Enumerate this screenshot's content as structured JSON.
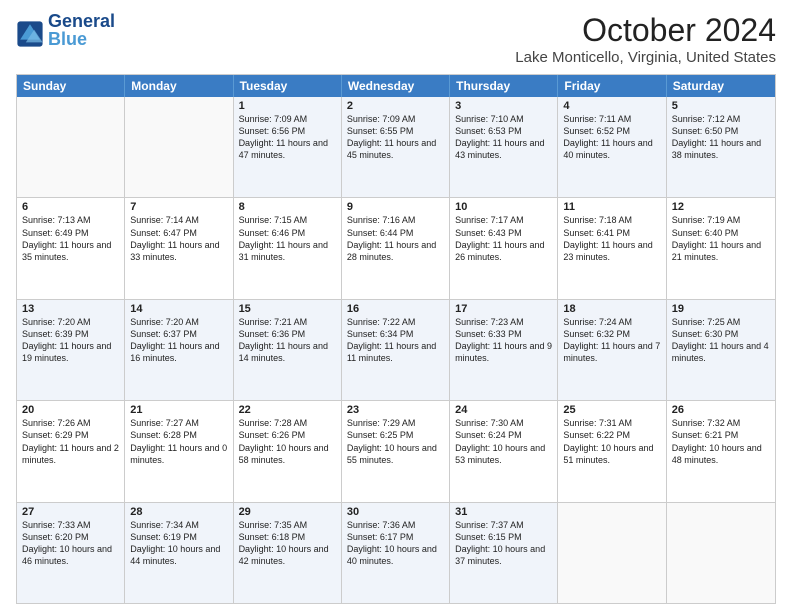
{
  "header": {
    "logo_text_general": "General",
    "logo_text_blue": "Blue",
    "main_title": "October 2024",
    "subtitle": "Lake Monticello, Virginia, United States"
  },
  "calendar": {
    "days": [
      "Sunday",
      "Monday",
      "Tuesday",
      "Wednesday",
      "Thursday",
      "Friday",
      "Saturday"
    ],
    "rows": [
      [
        {
          "day": "",
          "content": ""
        },
        {
          "day": "",
          "content": ""
        },
        {
          "day": "1",
          "content": "Sunrise: 7:09 AM\nSunset: 6:56 PM\nDaylight: 11 hours and 47 minutes."
        },
        {
          "day": "2",
          "content": "Sunrise: 7:09 AM\nSunset: 6:55 PM\nDaylight: 11 hours and 45 minutes."
        },
        {
          "day": "3",
          "content": "Sunrise: 7:10 AM\nSunset: 6:53 PM\nDaylight: 11 hours and 43 minutes."
        },
        {
          "day": "4",
          "content": "Sunrise: 7:11 AM\nSunset: 6:52 PM\nDaylight: 11 hours and 40 minutes."
        },
        {
          "day": "5",
          "content": "Sunrise: 7:12 AM\nSunset: 6:50 PM\nDaylight: 11 hours and 38 minutes."
        }
      ],
      [
        {
          "day": "6",
          "content": "Sunrise: 7:13 AM\nSunset: 6:49 PM\nDaylight: 11 hours and 35 minutes."
        },
        {
          "day": "7",
          "content": "Sunrise: 7:14 AM\nSunset: 6:47 PM\nDaylight: 11 hours and 33 minutes."
        },
        {
          "day": "8",
          "content": "Sunrise: 7:15 AM\nSunset: 6:46 PM\nDaylight: 11 hours and 31 minutes."
        },
        {
          "day": "9",
          "content": "Sunrise: 7:16 AM\nSunset: 6:44 PM\nDaylight: 11 hours and 28 minutes."
        },
        {
          "day": "10",
          "content": "Sunrise: 7:17 AM\nSunset: 6:43 PM\nDaylight: 11 hours and 26 minutes."
        },
        {
          "day": "11",
          "content": "Sunrise: 7:18 AM\nSunset: 6:41 PM\nDaylight: 11 hours and 23 minutes."
        },
        {
          "day": "12",
          "content": "Sunrise: 7:19 AM\nSunset: 6:40 PM\nDaylight: 11 hours and 21 minutes."
        }
      ],
      [
        {
          "day": "13",
          "content": "Sunrise: 7:20 AM\nSunset: 6:39 PM\nDaylight: 11 hours and 19 minutes."
        },
        {
          "day": "14",
          "content": "Sunrise: 7:20 AM\nSunset: 6:37 PM\nDaylight: 11 hours and 16 minutes."
        },
        {
          "day": "15",
          "content": "Sunrise: 7:21 AM\nSunset: 6:36 PM\nDaylight: 11 hours and 14 minutes."
        },
        {
          "day": "16",
          "content": "Sunrise: 7:22 AM\nSunset: 6:34 PM\nDaylight: 11 hours and 11 minutes."
        },
        {
          "day": "17",
          "content": "Sunrise: 7:23 AM\nSunset: 6:33 PM\nDaylight: 11 hours and 9 minutes."
        },
        {
          "day": "18",
          "content": "Sunrise: 7:24 AM\nSunset: 6:32 PM\nDaylight: 11 hours and 7 minutes."
        },
        {
          "day": "19",
          "content": "Sunrise: 7:25 AM\nSunset: 6:30 PM\nDaylight: 11 hours and 4 minutes."
        }
      ],
      [
        {
          "day": "20",
          "content": "Sunrise: 7:26 AM\nSunset: 6:29 PM\nDaylight: 11 hours and 2 minutes."
        },
        {
          "day": "21",
          "content": "Sunrise: 7:27 AM\nSunset: 6:28 PM\nDaylight: 11 hours and 0 minutes."
        },
        {
          "day": "22",
          "content": "Sunrise: 7:28 AM\nSunset: 6:26 PM\nDaylight: 10 hours and 58 minutes."
        },
        {
          "day": "23",
          "content": "Sunrise: 7:29 AM\nSunset: 6:25 PM\nDaylight: 10 hours and 55 minutes."
        },
        {
          "day": "24",
          "content": "Sunrise: 7:30 AM\nSunset: 6:24 PM\nDaylight: 10 hours and 53 minutes."
        },
        {
          "day": "25",
          "content": "Sunrise: 7:31 AM\nSunset: 6:22 PM\nDaylight: 10 hours and 51 minutes."
        },
        {
          "day": "26",
          "content": "Sunrise: 7:32 AM\nSunset: 6:21 PM\nDaylight: 10 hours and 48 minutes."
        }
      ],
      [
        {
          "day": "27",
          "content": "Sunrise: 7:33 AM\nSunset: 6:20 PM\nDaylight: 10 hours and 46 minutes."
        },
        {
          "day": "28",
          "content": "Sunrise: 7:34 AM\nSunset: 6:19 PM\nDaylight: 10 hours and 44 minutes."
        },
        {
          "day": "29",
          "content": "Sunrise: 7:35 AM\nSunset: 6:18 PM\nDaylight: 10 hours and 42 minutes."
        },
        {
          "day": "30",
          "content": "Sunrise: 7:36 AM\nSunset: 6:17 PM\nDaylight: 10 hours and 40 minutes."
        },
        {
          "day": "31",
          "content": "Sunrise: 7:37 AM\nSunset: 6:15 PM\nDaylight: 10 hours and 37 minutes."
        },
        {
          "day": "",
          "content": ""
        },
        {
          "day": "",
          "content": ""
        }
      ]
    ]
  }
}
